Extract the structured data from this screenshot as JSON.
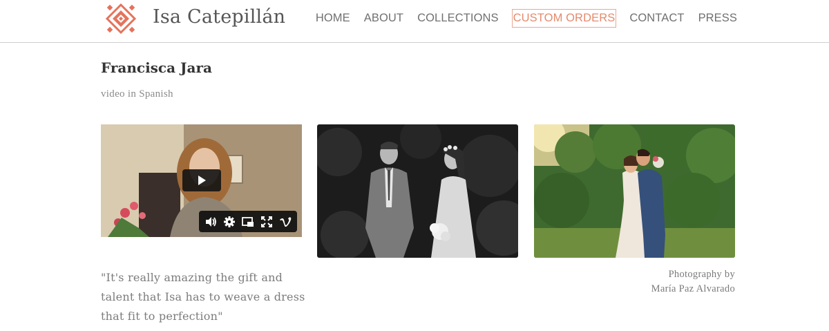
{
  "site": {
    "title": "Isa Catepillán",
    "logo_icon": "aztec-diamond-logo",
    "brand_color": "#e4735c"
  },
  "nav": {
    "items": [
      {
        "label": "HOME"
      },
      {
        "label": "ABOUT"
      },
      {
        "label": "COLLECTIONS"
      },
      {
        "label": "CUSTOM ORDERS",
        "active": true
      },
      {
        "label": "CONTACT"
      },
      {
        "label": "PRESS"
      }
    ]
  },
  "content": {
    "title": "Francisca Jara",
    "subtitle": "video in Spanish",
    "quote": "\"It's really amazing the gift and talent that Isa has to weave a dress that fit to perfection\"",
    "credit_line1": "Photography by",
    "credit_line2": "María Paz Alvarado"
  },
  "video": {
    "icons": [
      "play-icon",
      "volume-icon",
      "settings-icon",
      "pip-icon",
      "fullscreen-icon",
      "vimeo-icon"
    ]
  }
}
